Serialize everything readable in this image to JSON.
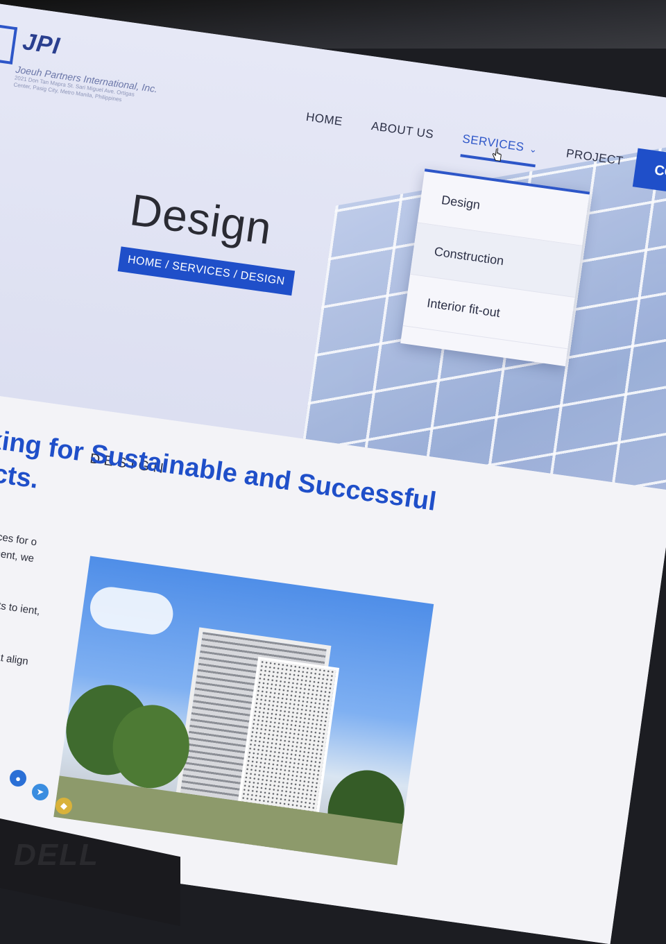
{
  "logo": {
    "name": "JPI",
    "company": "Joeuh Partners International, Inc.",
    "address": "2021 Don Tan Mapra St. Sari Miguel Ave. Ortigas Center, Pasig City, Metro Manila, Philippines"
  },
  "nav": {
    "items": [
      "HOME",
      "ABOUT US",
      "SERVICES",
      "PROJECT"
    ],
    "active": "SERVICES",
    "cta_label": "CO"
  },
  "dropdown": {
    "items": [
      "Design",
      "Construction",
      "Interior fit-out"
    ]
  },
  "hero": {
    "title": "Design",
    "breadcrumb": "HOME / SERVICES / DESIGN"
  },
  "section": {
    "label": "DESIGN",
    "headline": "Thinking for Sustainable and Successful Projects.",
    "paragraphs": [
      "nd planning services for o concept development, we dations.",
      "trategies and permits to ient, sustainable, and .",
      "n, we work closely hat align with your"
    ]
  },
  "monitor": {
    "brand": "DELL"
  },
  "colors": {
    "accent": "#1f4fc9",
    "text": "#2b2d3a"
  }
}
